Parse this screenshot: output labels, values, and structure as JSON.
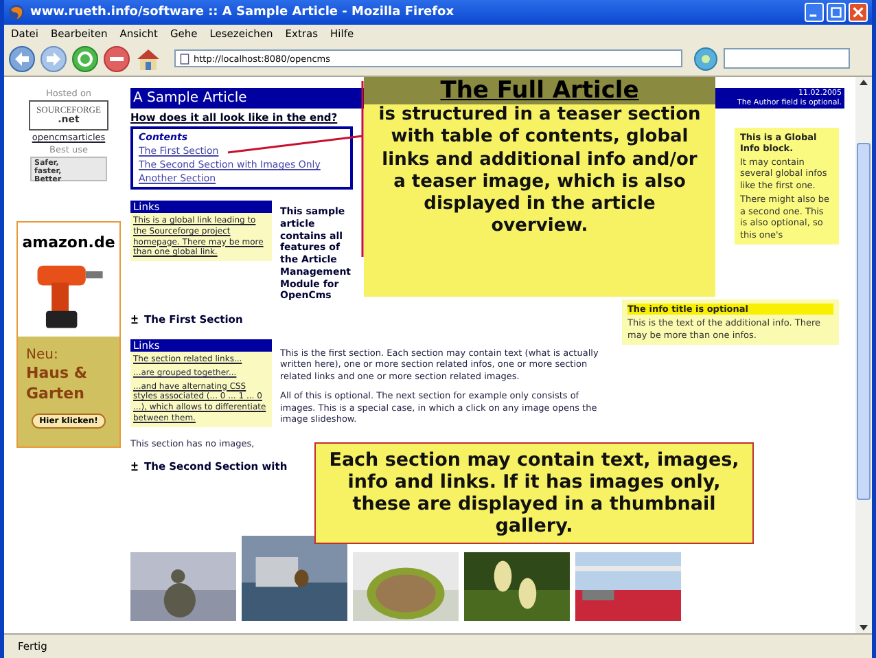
{
  "window": {
    "title": "www.rueth.info/software :: A Sample Article - Mozilla Firefox"
  },
  "menu": [
    "Datei",
    "Bearbeiten",
    "Ansicht",
    "Gehe",
    "Lesezeichen",
    "Extras",
    "Hilfe"
  ],
  "address_bar": {
    "value": "http://localhost:8080/opencms"
  },
  "sidebar": {
    "hosted_label": "Hosted on",
    "logo_name": "SOURCEFORGE",
    "logo_suffix": ".net",
    "project_link": "opencmsarticles",
    "best_use_label": "Best use",
    "browser_badge": "Safer, faster, Better"
  },
  "ad": {
    "logo": "amazon.de",
    "line1": "Neu:",
    "headline": "Haus & Garten",
    "button": "Hier klicken!"
  },
  "article": {
    "title": "A Sample Article",
    "date": "11.02.2005",
    "author_note": "The Author field is optional.",
    "subtitle": "How does it all look like in the end?",
    "contents": {
      "heading": "Contents",
      "items": [
        "The First Section",
        "The Second Section with Images Only",
        "Another Section"
      ]
    },
    "global_links": {
      "heading": "Links",
      "items": [
        "This is a global link leading to the Sourceforge project homepage. There may be more than one global link."
      ]
    },
    "teaser": "This sample article contains all features of the Article Management Module for OpenCms",
    "global_info": {
      "title": "This is a Global Info block.",
      "paragraphs": [
        "It may contain several global infos like the first one.",
        "There might also be a second one. This is also optional, so this one's"
      ]
    },
    "sections": [
      {
        "heading": "The First Section",
        "links": {
          "heading": "Links",
          "items": [
            "The section related links...",
            "...are grouped together...",
            "...and have alternating CSS styles associated (... 0 ... 1 ... 0 ...), which allows to differentiate between them."
          ]
        },
        "paragraphs": [
          "This is the first section. Each section may contain text (what is actually written here), one or more section related infos, one or more section related links and one or more section related images.",
          "All of this is optional. The next section for example only consists of images. This is a special case, in which a click on any image opens the image slideshow.",
          "This section has no images,"
        ],
        "info": {
          "title": "The info title is optional",
          "text": "This is the text of the additional info. There may be more than one infos."
        }
      },
      {
        "heading": "The Second Section with"
      }
    ]
  },
  "callouts": [
    {
      "title": "The Full Article",
      "text": "is structured in a teaser section with table of contents, global links and additional info and/or a teaser image, which is also displayed in the article overview."
    },
    {
      "text": "Each section may contain text, images, info and links. If it has images only, these are displayed in a thumbnail gallery."
    }
  ],
  "status_bar": "Fertig"
}
